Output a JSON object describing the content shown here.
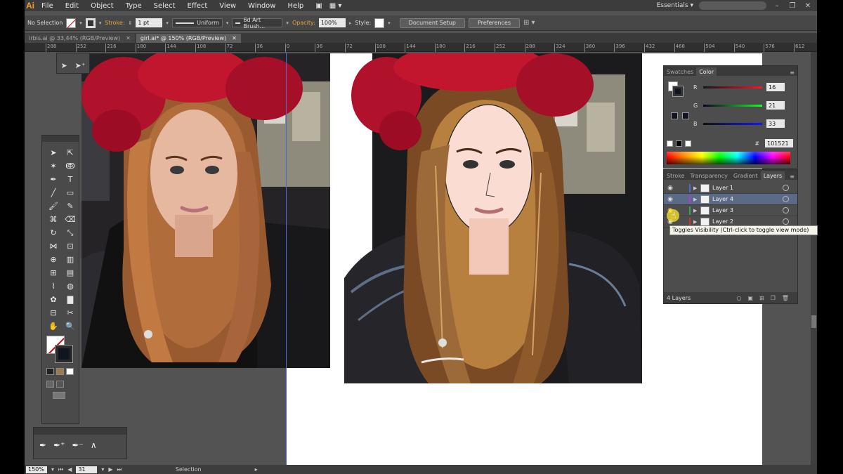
{
  "app": {
    "logo": "Ai"
  },
  "menu": [
    "File",
    "Edit",
    "Object",
    "Type",
    "Select",
    "Effect",
    "View",
    "Window",
    "Help"
  ],
  "workspace": {
    "label": "Essentials"
  },
  "control": {
    "selection": "No Selection",
    "stroke_label": "Stroke:",
    "stroke_weight": "1 pt",
    "profile": "Uniform",
    "brush": "6d Art Brush...",
    "opacity_label": "Opacity:",
    "opacity": "100%",
    "style_label": "Style:",
    "doc_setup": "Document Setup",
    "preferences": "Preferences"
  },
  "tabs": [
    {
      "label": "irbis.ai @ 33,44% (RGB/Preview)"
    },
    {
      "label": "girl.ai* @ 150% (RGB/Preview)"
    }
  ],
  "ruler": [
    "288",
    "252",
    "216",
    "180",
    "144",
    "108",
    "72",
    "36",
    "0",
    "36",
    "72",
    "108",
    "144",
    "180",
    "216",
    "252",
    "288",
    "324",
    "360",
    "396",
    "432",
    "468",
    "504",
    "540",
    "576",
    "612"
  ],
  "color_panel": {
    "tabs": [
      "Swatches",
      "Color"
    ],
    "r_label": "R",
    "r": "16",
    "g_label": "G",
    "g": "21",
    "b_label": "B",
    "b": "33",
    "hex_sign": "#",
    "hex": "101521",
    "colors": {
      "r": "#c02020",
      "g": "#20a020",
      "b": "#2030b0"
    }
  },
  "layers_panel": {
    "tabs": [
      "Stroke",
      "Transparency",
      "Gradient",
      "Layers"
    ],
    "layers": [
      {
        "name": "Layer 1",
        "color": "#4a6bd0"
      },
      {
        "name": "Layer 4",
        "color": "#a03fd0"
      },
      {
        "name": "Layer 3",
        "color": "#2aa84a"
      },
      {
        "name": "Layer 2",
        "color": "#d03030"
      }
    ],
    "count": "4 Layers"
  },
  "tooltip": {
    "text": "Toggles Visibility (Ctrl-click to toggle view mode)"
  },
  "status": {
    "zoom": "150%",
    "page": "31",
    "tool": "Selection"
  }
}
